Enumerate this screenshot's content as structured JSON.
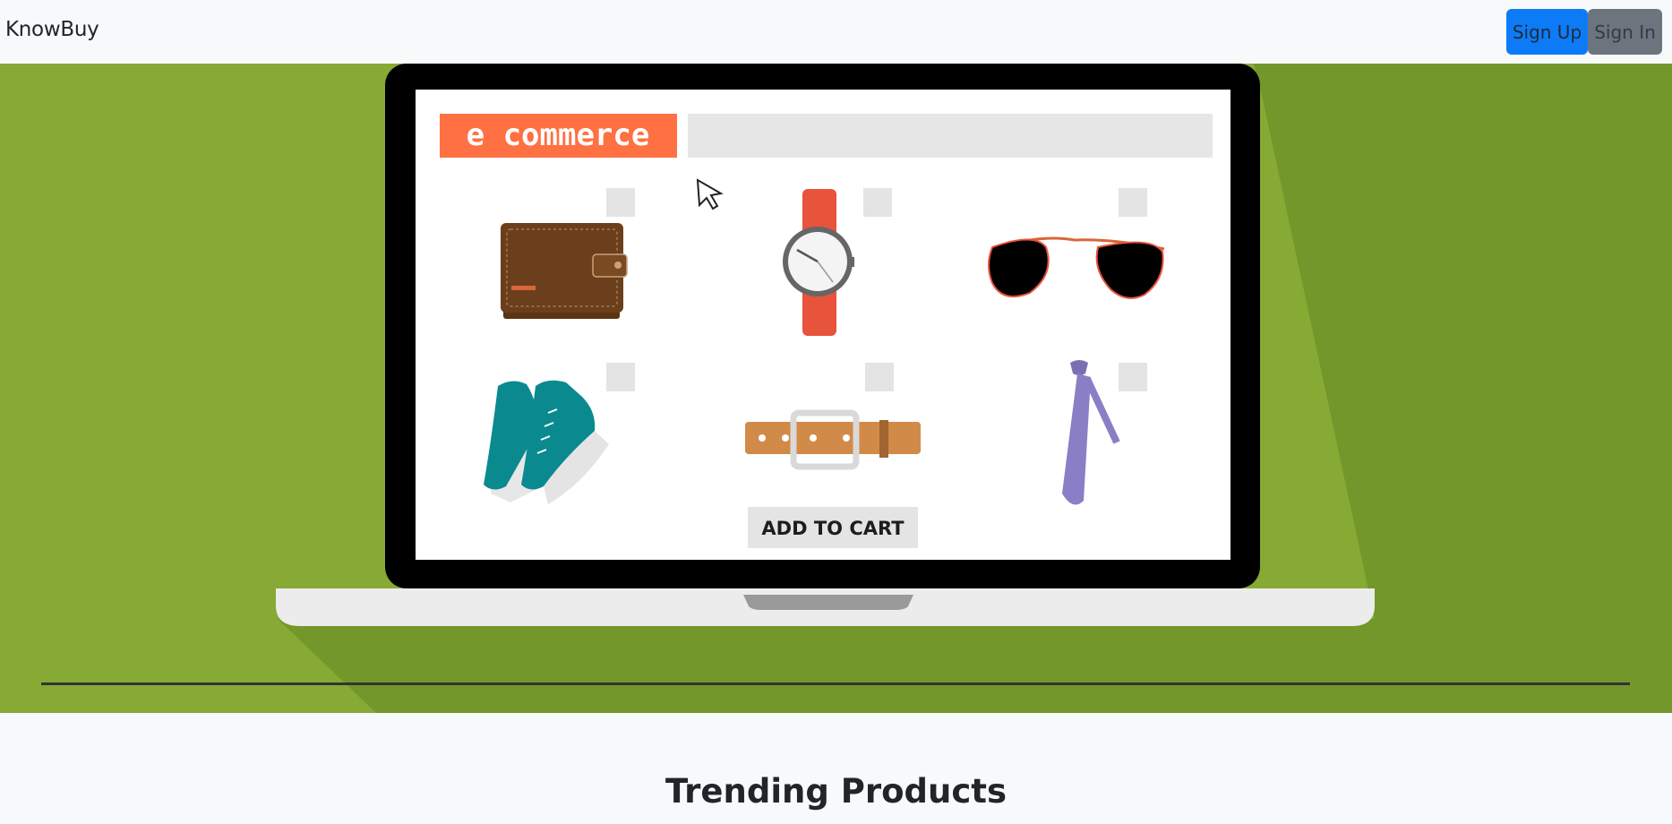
{
  "navbar": {
    "brand": "KnowBuy",
    "signup_label": "Sign Up",
    "signin_label": "Sign In"
  },
  "hero": {
    "logo_text": "e commerce",
    "add_to_cart_label": "ADD TO CART",
    "products": [
      "wallet",
      "watch",
      "sunglasses",
      "sneakers",
      "belt",
      "tie"
    ]
  },
  "main": {
    "section_title": "Trending Products"
  },
  "colors": {
    "primary": "#0d7bf6",
    "secondary": "#6c757d",
    "hero_green": "#86aa34",
    "logo_orange": "#ff7043"
  }
}
